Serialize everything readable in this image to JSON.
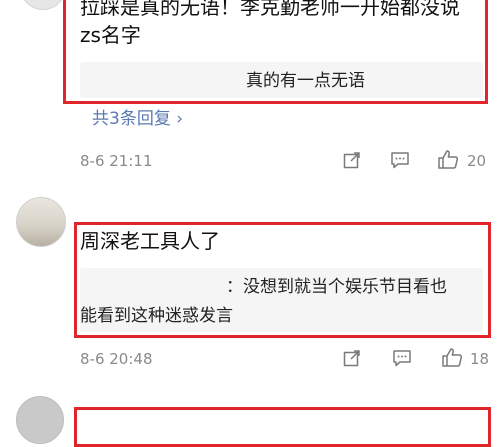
{
  "comments": [
    {
      "text": "拉踩是真的无语！李克勤老师一开始都没说zs名字",
      "quote": "真的有一点无语",
      "replies": "共3条回复 ›",
      "time": "8-6 21:11",
      "likes": "20"
    },
    {
      "text": "周深老工具人了",
      "quote_line1": "：没想到就当个娱乐节目看也",
      "quote_line2": "能看到这种迷惑发言",
      "time": "8-6 20:48",
      "likes": "18"
    }
  ],
  "colors": {
    "highlight": "#e0262a",
    "link": "#5b79b3",
    "meta": "#8a8a8a"
  },
  "icons": [
    "share-icon",
    "comment-icon",
    "like-icon"
  ]
}
